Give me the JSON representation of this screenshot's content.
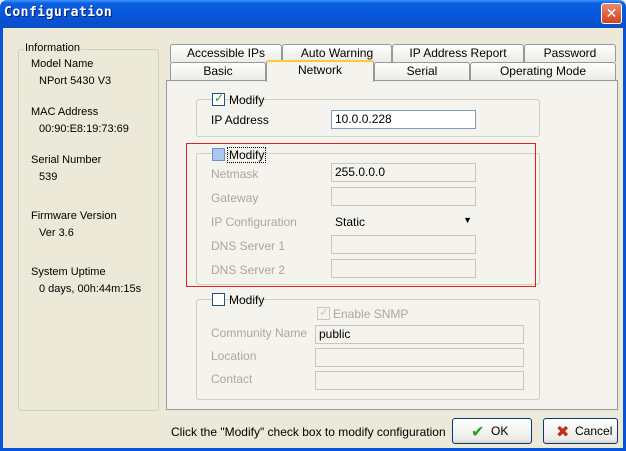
{
  "window": {
    "title": "Configuration",
    "close_label": "✕"
  },
  "info": {
    "title": "Information",
    "model_label": "Model Name",
    "model_value": "NPort 5430 V3",
    "mac_label": "MAC Address",
    "mac_value": "00:90:E8:19:73:69",
    "serial_label": "Serial Number",
    "serial_value": "539",
    "firmware_label": "Firmware Version",
    "firmware_value": "Ver 3.6",
    "uptime_label": "System Uptime",
    "uptime_value": "0 days, 00h:44m:15s"
  },
  "tabs": {
    "row1": [
      "Accessible IPs",
      "Auto Warning",
      "IP Address Report",
      "Password"
    ],
    "row2": [
      "Basic",
      "Network",
      "Serial",
      "Operating Mode"
    ],
    "active": "Network"
  },
  "ip_group": {
    "modify_label": "Modify",
    "ip_label": "IP Address",
    "ip_value": "10.0.0.228"
  },
  "net_group": {
    "modify_label": "Modify",
    "netmask_label": "Netmask",
    "netmask_value": "255.0.0.0",
    "gateway_label": "Gateway",
    "gateway_value": "",
    "ipconf_label": "IP Configuration",
    "ipconf_value": "Static",
    "dns1_label": "DNS Server 1",
    "dns1_value": "",
    "dns2_label": "DNS Server 2",
    "dns2_value": ""
  },
  "snmp_group": {
    "modify_label": "Modify",
    "enable_label": "Enable SNMP",
    "community_label": "Community Name",
    "community_value": "public",
    "location_label": "Location",
    "location_value": "",
    "contact_label": "Contact",
    "contact_value": ""
  },
  "footer": {
    "message": "Click the \"Modify\" check box to modify configuration",
    "ok_label": "OK",
    "cancel_label": "Cancel"
  },
  "colors": {
    "title_bar": "#0754d9",
    "dialog_bg": "#ece9d8",
    "highlight_red": "#e02020",
    "ok_check": "#21a121",
    "cancel_x": "#c0301c"
  }
}
